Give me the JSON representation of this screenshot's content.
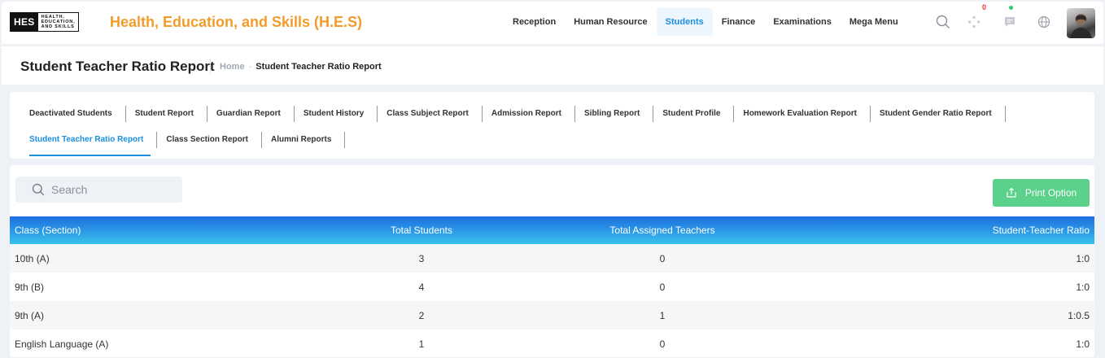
{
  "brand": {
    "logo_short": "HES",
    "logo_words": [
      "HEALTH,",
      "EDUCATION,",
      "AND SKILLS"
    ],
    "title": "Health, Education, and Skills (H.E.S)",
    "accent": "#f29c2b"
  },
  "nav": {
    "items": [
      {
        "label": "Reception"
      },
      {
        "label": "Human Resource"
      },
      {
        "label": "Students",
        "active": true
      },
      {
        "label": "Finance"
      },
      {
        "label": "Examinations"
      },
      {
        "label": "Mega Menu"
      }
    ]
  },
  "header_icons": {
    "search": "search-icon",
    "apps": "apps-icon",
    "apps_badge": "0",
    "messages": "message-icon",
    "language": "globe-icon",
    "avatar": "user-avatar"
  },
  "page": {
    "title": "Student Teacher Ratio Report",
    "breadcrumb_home": "Home",
    "breadcrumb_sep": "-",
    "breadcrumb_current": "Student Teacher Ratio Report"
  },
  "tabs": {
    "row1": [
      "Deactivated Students",
      "Student Report",
      "Guardian Report",
      "Student History",
      "Class Subject Report",
      "Admission Report",
      "Sibling Report",
      "Student Profile",
      "Homework Evaluation Report",
      "Student Gender Ratio Report"
    ],
    "row2": [
      "Student Teacher Ratio Report",
      "Class Section Report",
      "Alumni Reports"
    ],
    "active": "Student Teacher Ratio Report"
  },
  "search": {
    "placeholder": "Search",
    "value": ""
  },
  "print_button": {
    "label": "Print Option",
    "color": "#5bd18c"
  },
  "table": {
    "columns": [
      "Class (Section)",
      "Total Students",
      "Total Assigned Teachers",
      "Student-Teacher Ratio"
    ],
    "rows": [
      [
        "10th (A)",
        "3",
        "0",
        "1:0"
      ],
      [
        "9th (B)",
        "4",
        "0",
        "1:0"
      ],
      [
        "9th (A)",
        "2",
        "1",
        "1:0.5"
      ],
      [
        "English Language (A)",
        "1",
        "0",
        "1:0"
      ]
    ]
  }
}
